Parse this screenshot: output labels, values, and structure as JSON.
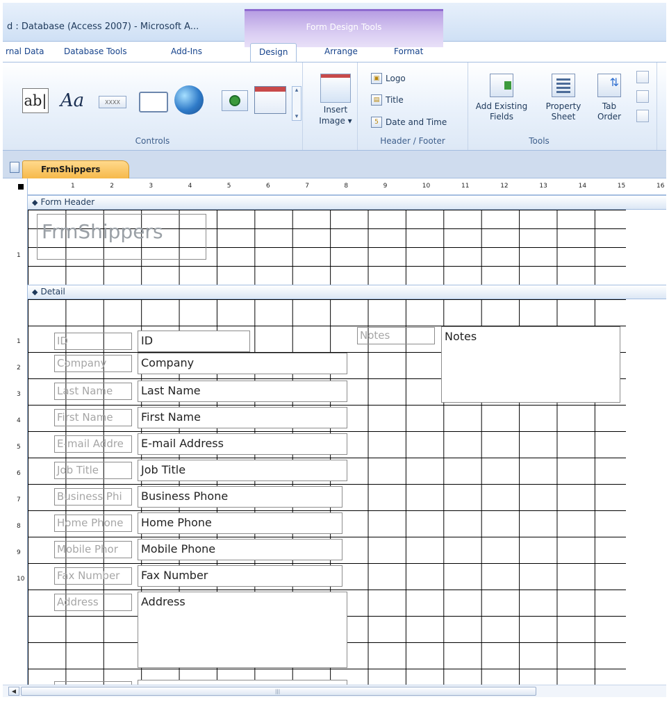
{
  "window": {
    "title": "d : Database (Access 2007)  -  Microsoft A...",
    "context_group": "Form Design Tools"
  },
  "tabs": [
    {
      "label": "rnal Data"
    },
    {
      "label": "Database Tools"
    },
    {
      "label": "Add-Ins"
    },
    {
      "label": "Design",
      "active": true
    },
    {
      "label": "Arrange"
    },
    {
      "label": "Format"
    }
  ],
  "ribbon": {
    "controls": {
      "label": "Controls",
      "textbox": "ab|",
      "label_ctl": "Aa",
      "button_ctl": "XXXX"
    },
    "insert_image": {
      "label": "Insert\nImage ▾",
      "line1": "Insert",
      "line2": "Image ▾"
    },
    "header_footer": {
      "label": "Header / Footer",
      "logo": "Logo",
      "title": "Title",
      "date_time": "Date and Time"
    },
    "tools": {
      "label": "Tools",
      "add_existing_1": "Add Existing",
      "add_existing_2": "Fields",
      "property_1": "Property",
      "property_2": "Sheet",
      "tab_order_1": "Tab",
      "tab_order_2": "Order"
    }
  },
  "document": {
    "tab": "FrmShippers"
  },
  "ruler": {
    "h_marks": [
      "1",
      "2",
      "3",
      "4",
      "5",
      "6",
      "7",
      "8",
      "9",
      "10",
      "11",
      "12",
      "13",
      "14",
      "15",
      "16"
    ],
    "v_header_marks": [
      "1"
    ],
    "v_detail_marks": [
      "1",
      "2",
      "3",
      "4",
      "5",
      "6",
      "7",
      "8",
      "9",
      "10"
    ]
  },
  "sections": {
    "header": "Form Header",
    "detail": "Detail"
  },
  "form_header": {
    "title": "FrmShippers"
  },
  "fields": [
    {
      "label": "ID",
      "value": "ID"
    },
    {
      "label": "Company",
      "value": "Company"
    },
    {
      "label": "Last Name",
      "value": "Last Name"
    },
    {
      "label": "First Name",
      "value": "First Name"
    },
    {
      "label": "E-mail Addre",
      "value": "E-mail Address"
    },
    {
      "label": "Job Title",
      "value": "Job Title"
    },
    {
      "label": "Business Phi",
      "value": "Business Phone"
    },
    {
      "label": "Home Phone",
      "value": "Home Phone"
    },
    {
      "label": "Mobile Phor",
      "value": "Mobile Phone"
    },
    {
      "label": "Fax Number",
      "value": "Fax Number"
    },
    {
      "label": "Address",
      "value": "Address"
    }
  ],
  "notes": {
    "label": "Notes",
    "value": "Notes"
  },
  "colors": {
    "ribbon_bg": "#dde8f6",
    "context_tab": "#b79ee3",
    "doc_tab": "#f6b94a",
    "grid": "#000000"
  }
}
